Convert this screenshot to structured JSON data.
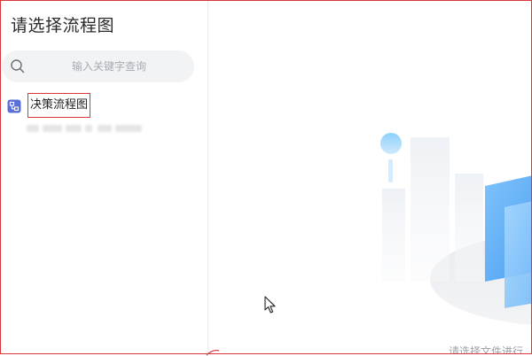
{
  "sidebar": {
    "title": "请选择流程图",
    "search": {
      "placeholder": "输入关键字查询",
      "icon": "search-icon"
    },
    "items": [
      {
        "label": "决策流程图",
        "icon": "flowchart-icon"
      }
    ]
  },
  "main": {
    "empty_hint": "请选择文件进行"
  },
  "colors": {
    "accent_icon": "#5b6fd8",
    "selection_border": "#d9363e",
    "illustration_blue": "#4a9df2"
  }
}
